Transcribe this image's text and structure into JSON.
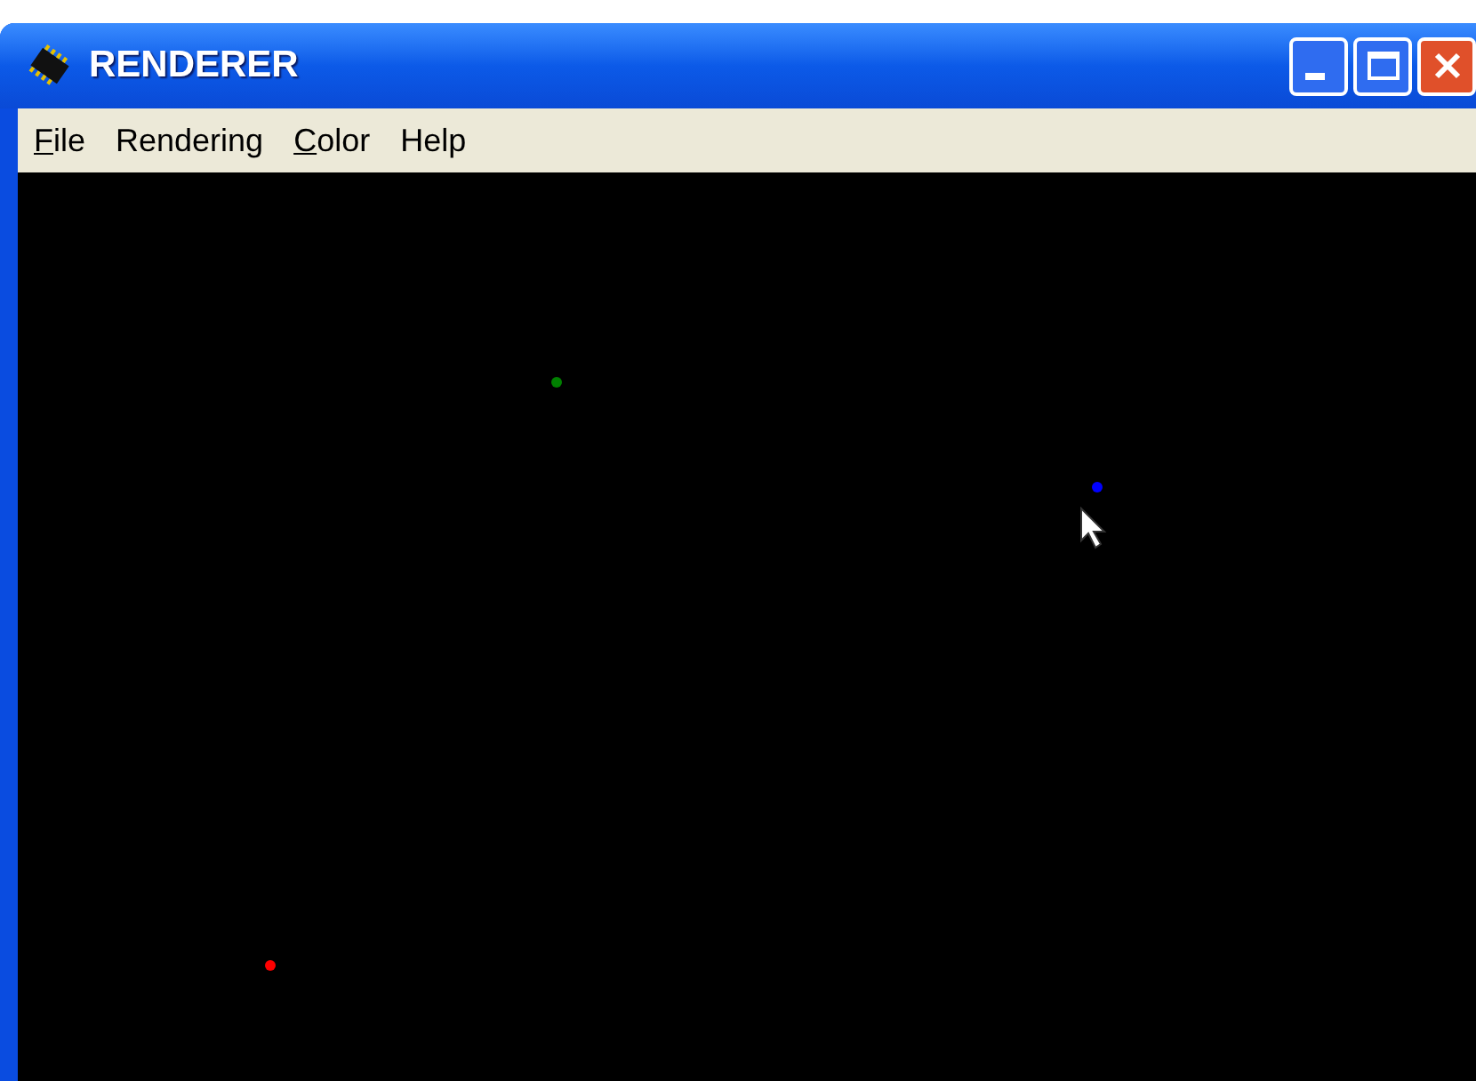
{
  "window": {
    "title": "RENDERER"
  },
  "menu": [
    {
      "label": "File",
      "mnemonic": true
    },
    {
      "label": "Rendering",
      "mnemonic": false
    },
    {
      "label": "Color",
      "mnemonic": true
    },
    {
      "label": "Help",
      "mnemonic": false
    }
  ],
  "canvas": {
    "points": [
      {
        "color": "#008000"
      },
      {
        "color": "#0000ff"
      },
      {
        "color": "#ff0000"
      }
    ]
  }
}
